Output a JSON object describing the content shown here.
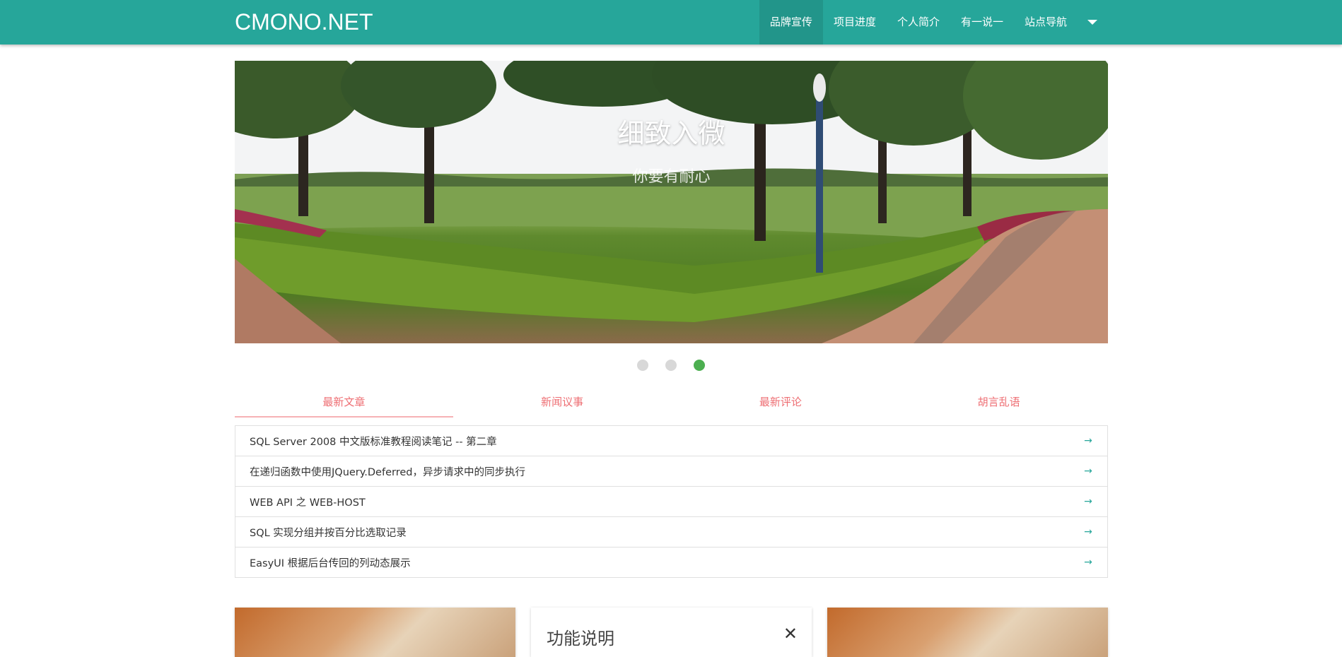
{
  "header": {
    "brand": "CMONO.NET",
    "nav": [
      "品牌宣传",
      "项目进度",
      "个人简介",
      "有一说一",
      "站点导航"
    ]
  },
  "carousel": {
    "title": "细致入微",
    "subtitle": "你要有耐心",
    "active_index": 2,
    "slides": 3
  },
  "tabs": [
    "最新文章",
    "新闻议事",
    "最新评论",
    "胡言乱语"
  ],
  "articles": [
    "SQL Server 2008 中文版标准教程阅读笔记 -- 第二章",
    "在递归函数中使用JQuery.Deferred，异步请求中的同步执行",
    "WEB API 之 WEB-HOST",
    "SQL 实现分组并按百分比选取记录",
    "EasyUI 根据后台传回的列动态展示"
  ],
  "cards": {
    "center_title": "功能说明"
  },
  "colors": {
    "primary": "#26a69a",
    "tab_text": "#ee6e73",
    "dot_active": "#4caf50"
  }
}
